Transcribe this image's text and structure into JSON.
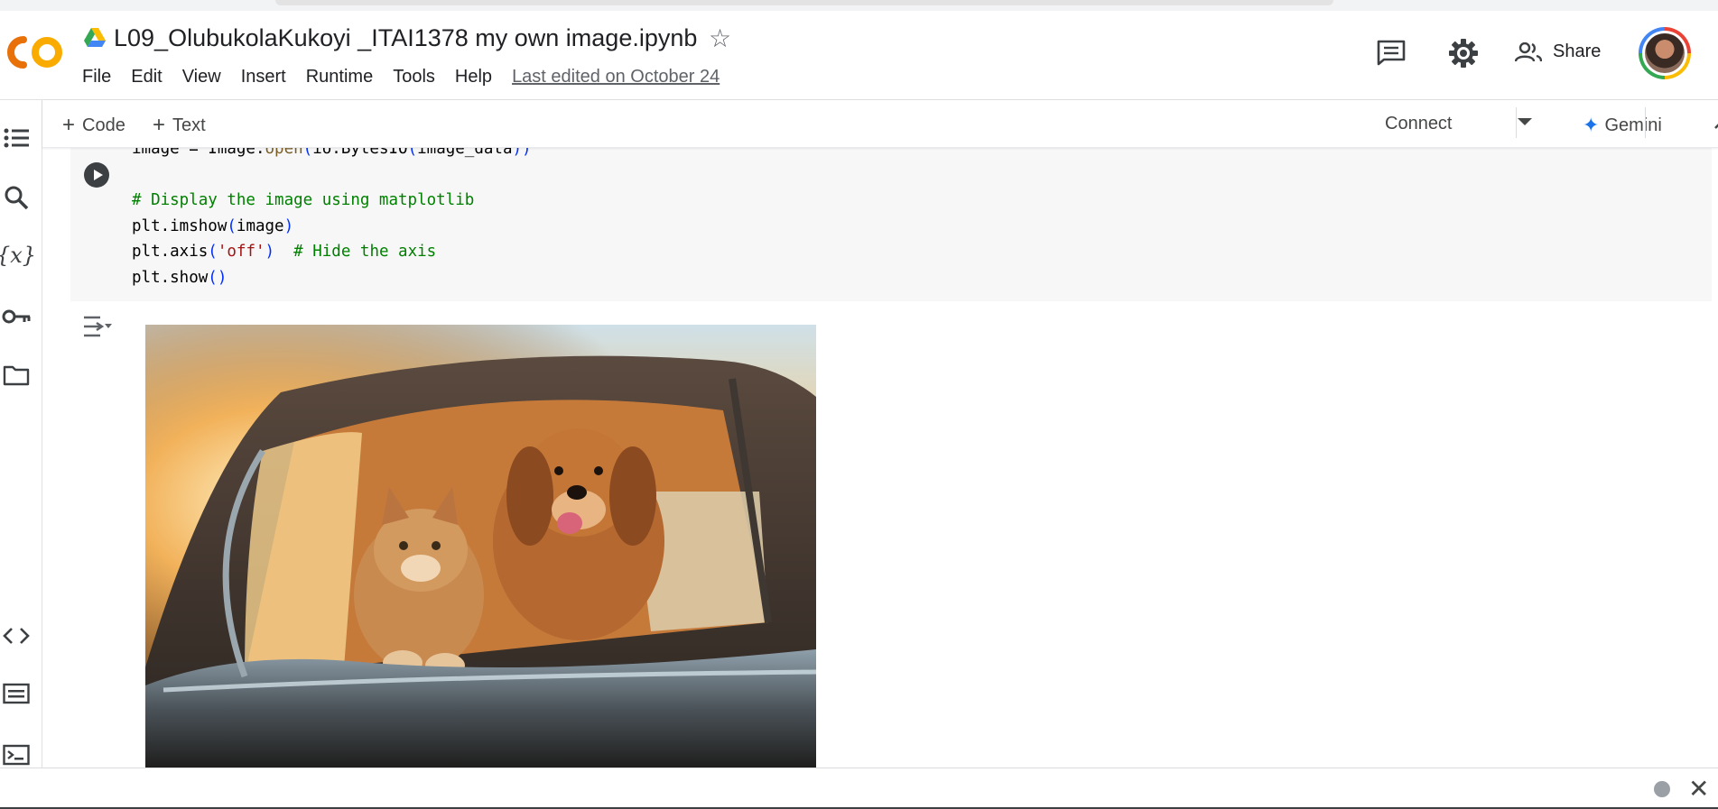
{
  "header": {
    "logo_text": "CO",
    "filename": "L09_OlubukolaKukoyi _ITAI1378 my own image.ipynb",
    "menu": [
      "File",
      "Edit",
      "View",
      "Insert",
      "Runtime",
      "Tools",
      "Help"
    ],
    "last_edited": "Last edited on October 24",
    "share_label": "Share"
  },
  "sidebar": {
    "icons": [
      "table-of-contents-icon",
      "search-icon",
      "variables-icon",
      "secrets-key-icon",
      "files-folder-icon",
      "code-snippets-icon",
      "command-palette-icon",
      "terminal-icon"
    ],
    "variables_glyph": "{x}"
  },
  "toolbar": {
    "code_label": "Code",
    "text_label": "Text",
    "connect_label": "Connect",
    "gemini_label": "Gemini"
  },
  "cell": {
    "code_lines": [
      "image = Image.open(io.BytesIO(image_data))",
      "",
      "# Display the image using matplotlib",
      "plt.imshow(image)",
      "plt.axis('off')  # Hide the axis",
      "plt.show()"
    ]
  },
  "colors": {
    "logo_orange": "#f9ab00",
    "logo_dark_orange": "#e8710a",
    "comment_green": "#008000",
    "string_red": "#a31515",
    "gemini_blue": "#1a73e8"
  }
}
